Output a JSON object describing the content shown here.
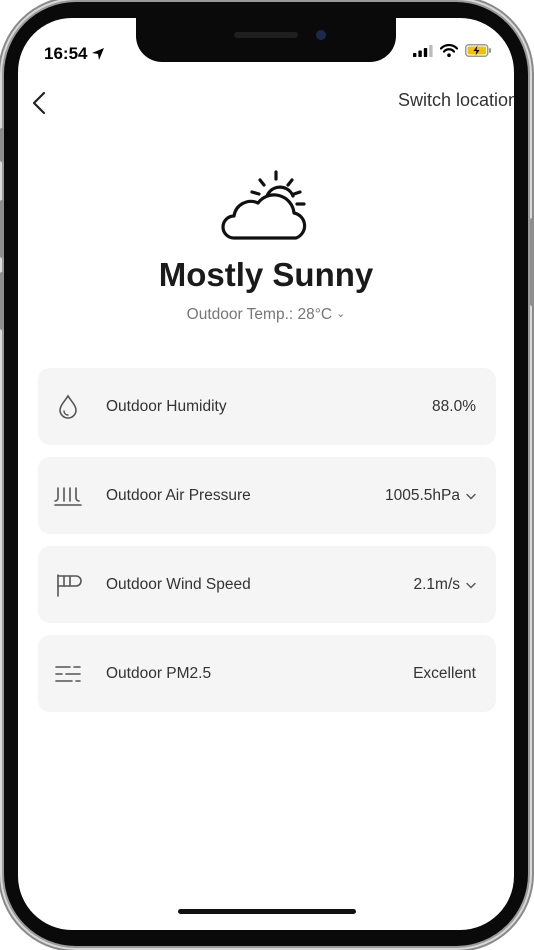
{
  "status_bar": {
    "time": "16:54"
  },
  "header": {
    "switch_location": "Switch location"
  },
  "weather": {
    "condition": "Mostly Sunny",
    "temp_label": "Outdoor Temp.: 28°C",
    "icon": "partly-cloudy-icon"
  },
  "metrics": [
    {
      "label": "Outdoor Humidity",
      "value": "88.0%",
      "icon": "droplet-icon",
      "has_dropdown": false
    },
    {
      "label": "Outdoor Air Pressure",
      "value": "1005.5hPa",
      "icon": "pressure-icon",
      "has_dropdown": true
    },
    {
      "label": "Outdoor Wind Speed",
      "value": "2.1m/s",
      "icon": "wind-flag-icon",
      "has_dropdown": true
    },
    {
      "label": "Outdoor PM2.5",
      "value": "Excellent",
      "icon": "haze-lines-icon",
      "has_dropdown": false
    }
  ],
  "colors": {
    "card_background": "#f5f5f5",
    "text_primary": "#1a1a1a",
    "text_secondary": "#777777",
    "battery_charging": "#f2c200"
  }
}
